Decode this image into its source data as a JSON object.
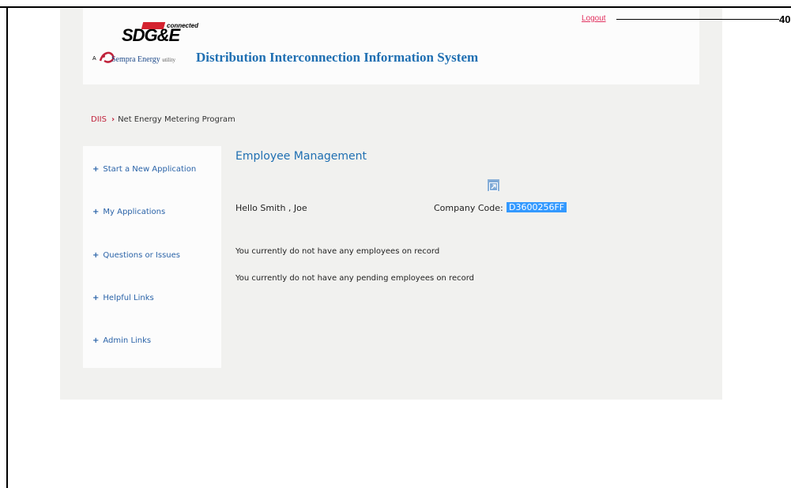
{
  "header": {
    "logo": {
      "sdge": "SDG&E",
      "connected": "connected",
      "a": "A",
      "sempra": "Sempra Energy",
      "utility": "utility"
    },
    "site_title": "Distribution Interconnection Information System",
    "logout_label": "Logout",
    "reference_number": "40"
  },
  "breadcrumb": {
    "root": "DIIS",
    "separator": "›",
    "current": "Net Energy Metering Program"
  },
  "sidebar": {
    "items": [
      {
        "label": "Start a New Application"
      },
      {
        "label": "My Applications"
      },
      {
        "label": "Questions or Issues"
      },
      {
        "label": "Helpful Links"
      },
      {
        "label": "Admin Links"
      }
    ]
  },
  "main": {
    "title": "Employee Management",
    "greeting": "Hello Smith , Joe",
    "company_code_label": "Company Code:",
    "company_code_value": "D3600256FF",
    "messages": [
      "You currently do not have any employees on record",
      "You currently do not have any pending employees on record"
    ]
  },
  "colors": {
    "accent": "#1f6fb2",
    "logout": "#e2315f",
    "breadcrumb": "#c0223b",
    "selection": "#3399ff"
  }
}
